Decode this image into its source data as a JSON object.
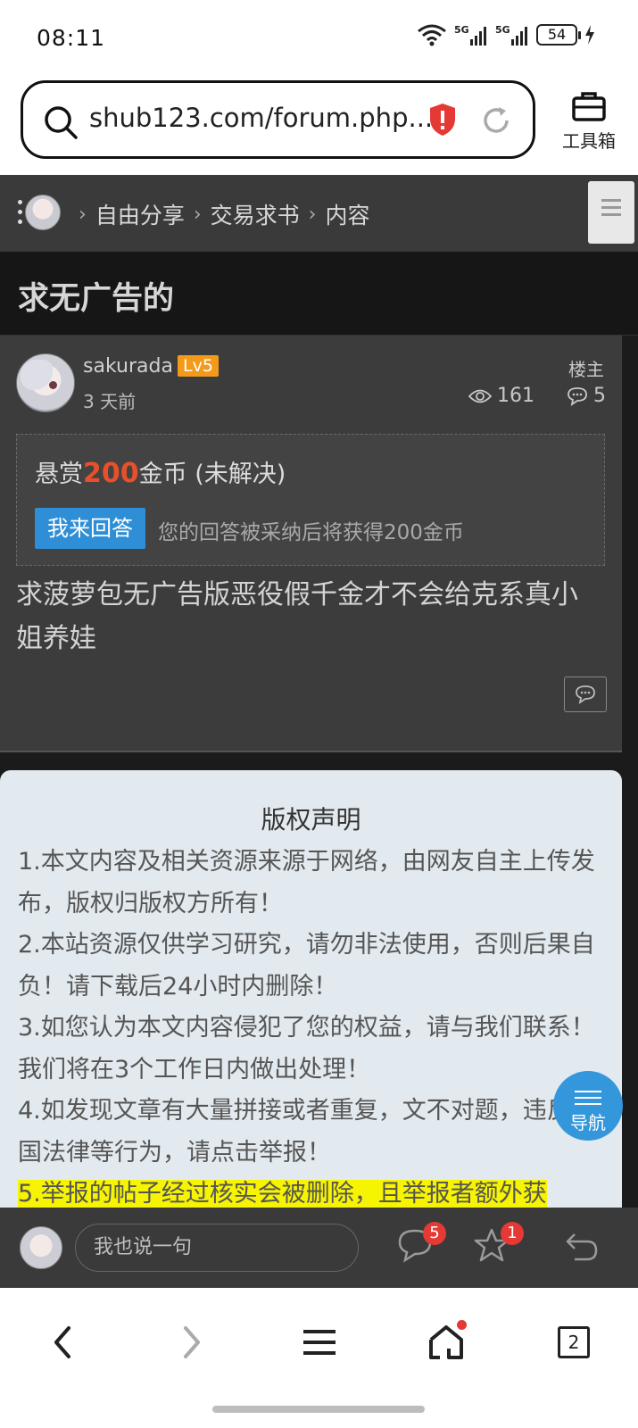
{
  "status_bar": {
    "time": "08:11",
    "battery": "54"
  },
  "browser": {
    "url": "shub123.com/forum.php...",
    "tools_label": "工具箱",
    "tab_count": "2"
  },
  "breadcrumb": {
    "items": [
      "自由分享",
      "交易求书",
      "内容"
    ]
  },
  "page": {
    "title": "求无广告的"
  },
  "post": {
    "username": "sakurada",
    "level": "Lv5",
    "time": "3 天前",
    "floor": "楼主",
    "views": "161",
    "replies": "5",
    "bounty_prefix": "悬赏",
    "bounty_amount": "200",
    "bounty_suffix": "金币 (未解决)",
    "answer_button": "我来回答",
    "answer_tip": "您的回答被采纳后将获得200金币",
    "content": "求菠萝包无广告版恶役假千金才不会给克系真小姐养娃"
  },
  "copyright": {
    "title": "版权声明",
    "items": [
      "1.本文内容及相关资源来源于网络，由网友自主上传发布，版权归版权方所有！",
      "2.本站资源仅供学习研究，请勿非法使用，否则后果自负！请下载后24小时内删除！",
      "3.如您认为本文内容侵犯了您的权益，请与我们联系！我们将在3个工作日内做出处理！",
      "4.如发现文章有大量拼接或者重复，文不对题，违反中国法律等行为，请点击举报！"
    ],
    "highlight": "5.举报的帖子经过核实会被删除，且举报者额外获"
  },
  "fab": {
    "label": "导航"
  },
  "reply_bar": {
    "placeholder": "我也说一句",
    "comment_badge": "5",
    "favorite_badge": "1"
  },
  "colors": {
    "accent_blue": "#2f8fd6",
    "bounty_red": "#e7502b",
    "level_orange": "#f39a1a",
    "badge_red": "#e53935",
    "highlight_yellow": "#f6f400"
  }
}
